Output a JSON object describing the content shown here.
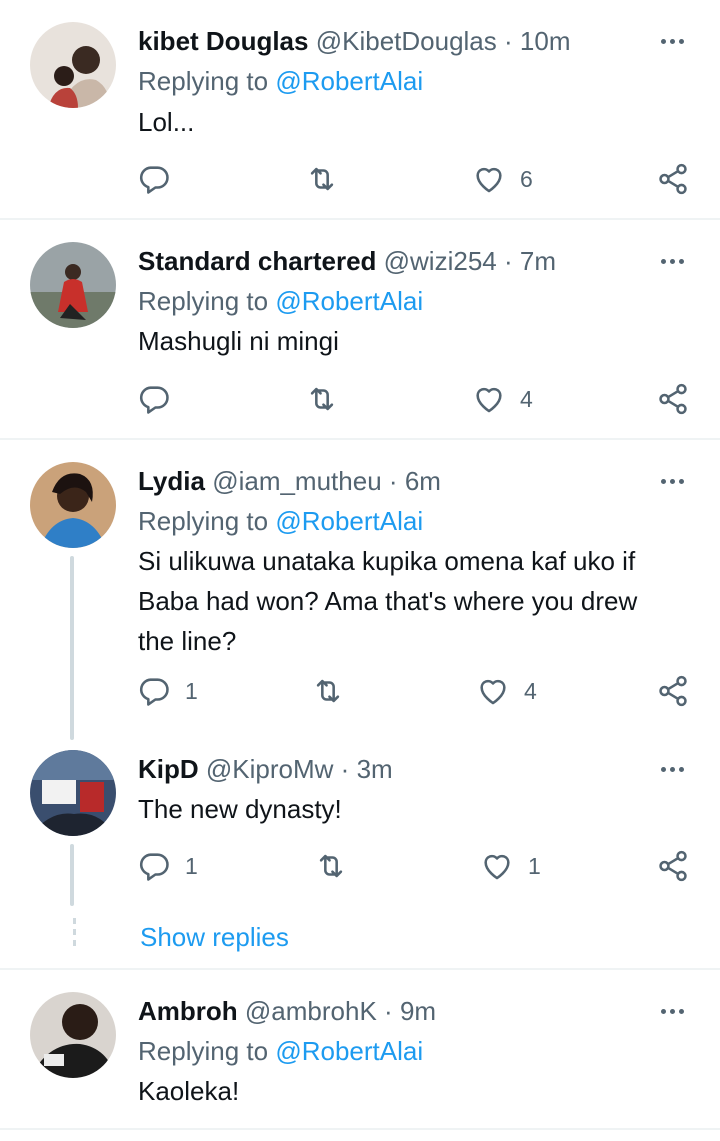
{
  "tweets": [
    {
      "name": "kibet Douglas",
      "handle": "@KibetDouglas",
      "sep": "·",
      "time": "10m",
      "replying_prefix": "Replying to",
      "replying_to": "@RobertAlai",
      "text": "Lol...",
      "reply_count": "",
      "retweet_count": "",
      "like_count": "6"
    },
    {
      "name": "Standard chartered",
      "handle": "@wizi254",
      "sep": "·",
      "time": "7m",
      "replying_prefix": "Replying to",
      "replying_to": "@RobertAlai",
      "text": "Mashugli ni mingi",
      "reply_count": "",
      "retweet_count": "",
      "like_count": "4"
    },
    {
      "name": "Lydia",
      "handle": "@iam_mutheu",
      "sep": "·",
      "time": "6m",
      "replying_prefix": "Replying to",
      "replying_to": "@RobertAlai",
      "text_lines": [
        "Si ulikuwa unataka kupika omena kaf uko if",
        "Baba had won? Ama that's where you drew",
        "the line?"
      ],
      "reply_count": "1",
      "retweet_count": "",
      "like_count": "4"
    },
    {
      "name": "KipD",
      "handle": "@KiproMw",
      "sep": "·",
      "time": "3m",
      "text": "The new dynasty!",
      "reply_count": "1",
      "retweet_count": "",
      "like_count": "1"
    },
    {
      "name": "Ambroh",
      "handle": "@ambrohK",
      "sep": "·",
      "time": "9m",
      "replying_prefix": "Replying to",
      "replying_to": "@RobertAlai",
      "text": "Kaoleka!"
    }
  ],
  "show_replies": "Show replies",
  "colors": {
    "accent": "#1d9bf0",
    "secondary_text": "#536471",
    "divider": "#eff3f4",
    "thread_line": "#cfd9de"
  },
  "icons": [
    "more-icon",
    "reply-icon",
    "retweet-icon",
    "like-icon",
    "share-icon"
  ]
}
